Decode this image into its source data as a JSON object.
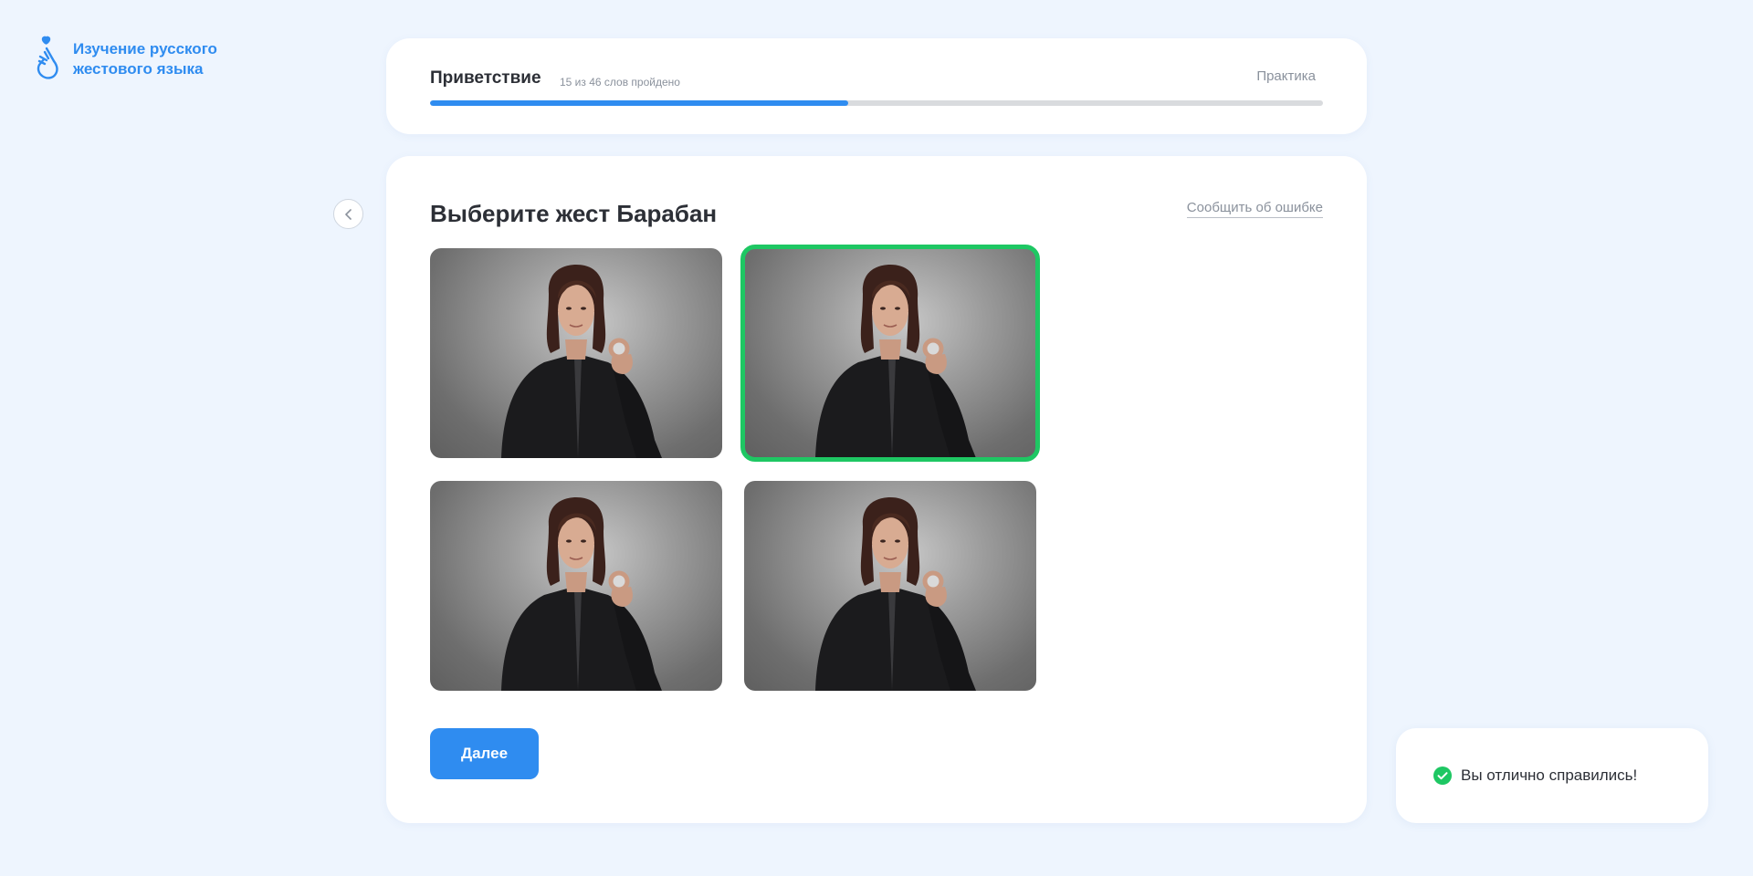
{
  "app": {
    "title_line1": "Изучение русского",
    "title_line2": "жестового языка",
    "brand_color": "#2f8cf0"
  },
  "lesson": {
    "title": "Приветствие",
    "progress_text": "15 из 46 слов пройдено",
    "words_done": 15,
    "words_total": 46,
    "progress_fraction": 0.4686,
    "practice_label": "Практика"
  },
  "task": {
    "question": "Выберите жест Барабан",
    "report_label": "Сообщить об ошибке",
    "options": [
      {
        "icon": "avatar-sign-video",
        "selected": false
      },
      {
        "icon": "avatar-sign-video",
        "selected": true
      },
      {
        "icon": "avatar-sign-video",
        "selected": false
      },
      {
        "icon": "avatar-sign-video",
        "selected": false
      }
    ],
    "selected_color": "#1ec763",
    "next_label": "Далее"
  },
  "toast": {
    "message": "Вы отлично справились!",
    "icon": "check-circle-icon",
    "color": "#1ec763"
  }
}
